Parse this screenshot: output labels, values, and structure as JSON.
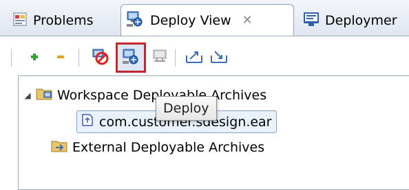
{
  "tabs": [
    {
      "label": "Problems",
      "icon": "problems-icon"
    },
    {
      "label": "Deploy View",
      "icon": "deploy-view-icon",
      "close": "✕"
    },
    {
      "label": "Deploymer",
      "icon": "monitor-icon"
    }
  ],
  "toolbar": {
    "buttons": [
      "add",
      "remove",
      "undeploy",
      "deploy",
      "redeploy",
      "export",
      "import"
    ]
  },
  "tree": {
    "workspace_label": "Workspace Deployable Archives",
    "child_label": "com.customer.sdesign.ear",
    "external_label": "External Deployable Archives"
  },
  "tooltip": {
    "text": "Deploy"
  },
  "colors": {
    "highlight": "#c0282d",
    "add": "#2fa52f",
    "remove": "#e0a51d"
  }
}
